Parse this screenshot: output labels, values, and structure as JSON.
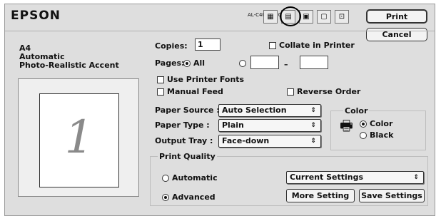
{
  "header": {
    "brand": "EPSON",
    "printer_model": "AL-C4000 1.00"
  },
  "buttons": {
    "print": "Print",
    "cancel": "Cancel",
    "more_setting": "More Setting",
    "save_settings": "Save Settings"
  },
  "summary": {
    "line1": "A4",
    "line2": "Automatic",
    "line3": "Photo-Realistic Accent",
    "preview_number": "1"
  },
  "copies": {
    "label": "Copies:",
    "value": "1",
    "collate_label": "Collate in Printer"
  },
  "pages": {
    "label": "Pages:",
    "all_label": "All",
    "range_dash": "–",
    "from": "",
    "to": ""
  },
  "options": {
    "printer_fonts": "Use Printer Fonts",
    "manual_feed": "Manual Feed",
    "reverse_order": "Reverse Order"
  },
  "paper_source": {
    "label": "Paper Source :",
    "value": "Auto Selection"
  },
  "paper_type": {
    "label": "Paper Type :",
    "value": "Plain"
  },
  "output_tray": {
    "label": "Output Tray :",
    "value": "Face-down"
  },
  "color": {
    "title": "Color",
    "color_label": "Color",
    "black_label": "Black",
    "selected": "Color"
  },
  "print_quality": {
    "title": "Print Quality",
    "automatic_label": "Automatic",
    "advanced_label": "Advanced",
    "selected": "Advanced",
    "settings_value": "Current Settings"
  },
  "icons": {
    "popup_arrow": "⇕"
  }
}
